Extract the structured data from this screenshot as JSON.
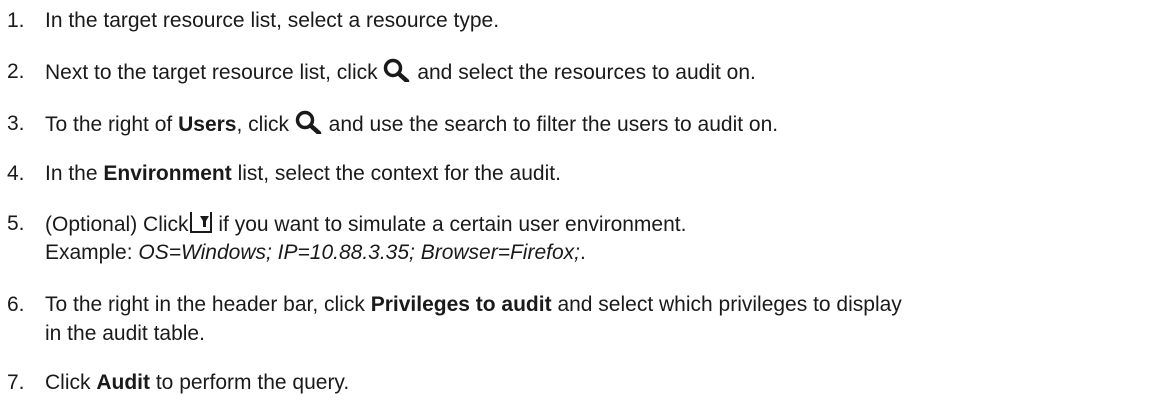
{
  "steps": [
    {
      "number": "1.",
      "text": "In the target resource list, select a resource type."
    },
    {
      "number": "2.",
      "before": "Next to the target resource list, click",
      "icon": "search-icon",
      "after": "and select the resources to audit on."
    },
    {
      "number": "3.",
      "before": "To the right of",
      "bold": "Users",
      "middle": ", click",
      "icon": "search-icon",
      "after": "and use the search to filter the users to audit on."
    },
    {
      "number": "4.",
      "before": "In the",
      "bold": "Environment",
      "after": "list, select the context for the audit."
    },
    {
      "number": "5.",
      "before": "(Optional) Click",
      "icon": "filter-icon",
      "after": "if you want to simulate a certain user environment.",
      "example_label": "Example:",
      "example_value": "OS=Windows; IP=10.88.3.35; Browser=Firefox;",
      "example_end": "."
    },
    {
      "number": "6.",
      "before": "To the right in the header bar, click",
      "bold": "Privileges to audit",
      "after": "and select which privileges to display",
      "line2": "in the audit table."
    },
    {
      "number": "7.",
      "before": "Click",
      "bold": "Audit",
      "after": "to perform the query."
    }
  ]
}
